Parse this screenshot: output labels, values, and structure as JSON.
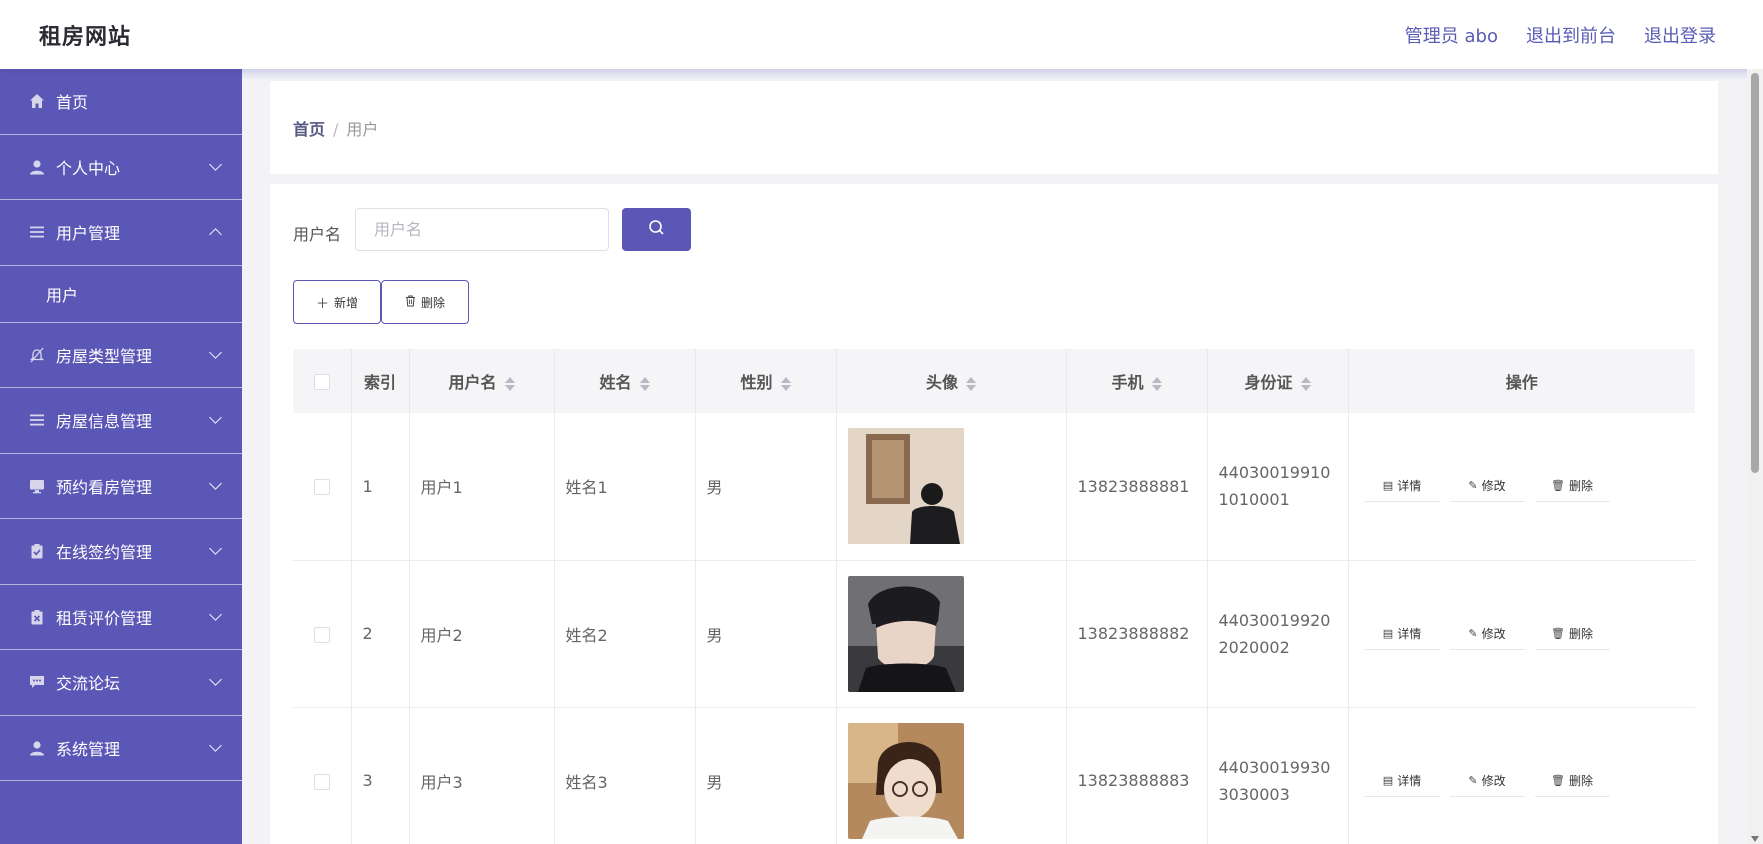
{
  "header": {
    "brand": "租房网站",
    "links": [
      {
        "label": "管理员 abo"
      },
      {
        "label": "退出到前台"
      },
      {
        "label": "退出登录"
      }
    ]
  },
  "sidebar": {
    "items": [
      {
        "label": "首页",
        "icon": "home-icon"
      },
      {
        "label": "个人中心",
        "icon": "user-icon"
      },
      {
        "label": "用户管理",
        "icon": "list-icon",
        "expanded": true
      },
      {
        "label": "房屋类型管理",
        "icon": "bell-off-icon"
      },
      {
        "label": "房屋信息管理",
        "icon": "list-icon"
      },
      {
        "label": "预约看房管理",
        "icon": "monitor-icon"
      },
      {
        "label": "在线签约管理",
        "icon": "clipboard-check-icon"
      },
      {
        "label": "租赁评价管理",
        "icon": "clipboard-x-icon"
      },
      {
        "label": "交流论坛",
        "icon": "chat-icon"
      },
      {
        "label": "系统管理",
        "icon": "user-icon"
      }
    ],
    "submenu": {
      "label": "用户"
    }
  },
  "breadcrumb": {
    "home": "首页",
    "sep": "/",
    "current": "用户"
  },
  "search": {
    "label": "用户名",
    "placeholder": "用户名",
    "value": ""
  },
  "actions": {
    "add": "新增",
    "delete": "删除"
  },
  "table": {
    "columns": [
      "索引",
      "用户名",
      "姓名",
      "性别",
      "头像",
      "手机",
      "身份证",
      "操作"
    ],
    "rows": [
      {
        "index": "1",
        "username": "用户1",
        "name": "姓名1",
        "gender": "男",
        "phone": "13823888881",
        "idcard": "440300199101010001"
      },
      {
        "index": "2",
        "username": "用户2",
        "name": "姓名2",
        "gender": "男",
        "phone": "13823888882",
        "idcard": "440300199202020002"
      },
      {
        "index": "3",
        "username": "用户3",
        "name": "姓名3",
        "gender": "男",
        "phone": "13823888883",
        "idcard": "440300199303030003"
      }
    ],
    "ops": {
      "detail": "详情",
      "edit": "修改",
      "delete": "删除"
    }
  },
  "colors": {
    "primary": "#5b57b6",
    "accent_text": "#5a5bb5"
  }
}
